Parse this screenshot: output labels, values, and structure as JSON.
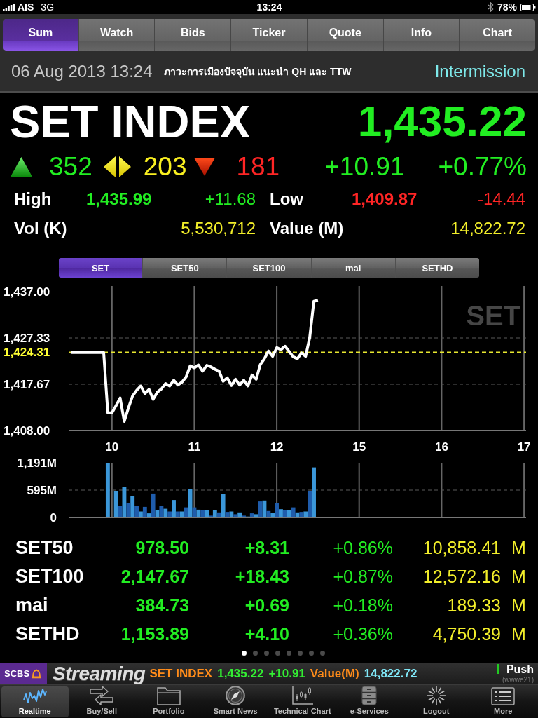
{
  "status_bar": {
    "carrier": "AIS",
    "network": "3G",
    "time": "13:24",
    "battery": "78%"
  },
  "tabs": [
    {
      "label": "Sum",
      "selected": true
    },
    {
      "label": "Watch",
      "selected": false
    },
    {
      "label": "Bids",
      "selected": false
    },
    {
      "label": "Ticker",
      "selected": false
    },
    {
      "label": "Quote",
      "selected": false
    },
    {
      "label": "Info",
      "selected": false
    },
    {
      "label": "Chart",
      "selected": false
    }
  ],
  "info_bar": {
    "datetime": "06 Aug 2013 13:24",
    "news": "ภาวะการเมืองปัจจุบัน แนะนำ QH และ TTW",
    "session": "Intermission"
  },
  "index": {
    "name": "SET INDEX",
    "last": "1,435.22",
    "change": "+10.91",
    "percent": "+0.77%"
  },
  "breadth": [
    {
      "kind": "up",
      "count": "352"
    },
    {
      "kind": "unchanged",
      "count": "203"
    },
    {
      "kind": "down",
      "count": "181"
    }
  ],
  "stats": [
    {
      "kind": "up",
      "label": "High",
      "value": "1,435.99",
      "change": "+11.68"
    },
    {
      "kind": "down",
      "label": "Low",
      "value": "1,409.87",
      "change": "-14.44"
    },
    {
      "kind": "total",
      "label": "Vol (K)",
      "value": "5,530,712"
    },
    {
      "kind": "total",
      "label": "Value (M)",
      "value": "14,822.72"
    }
  ],
  "chart_tabs": [
    {
      "label": "SET",
      "selected": true
    },
    {
      "label": "SET50",
      "selected": false
    },
    {
      "label": "SET100",
      "selected": false
    },
    {
      "label": "mai",
      "selected": false
    },
    {
      "label": "SETHD",
      "selected": false
    }
  ],
  "price_chart": {
    "chart_data": {
      "type": "line",
      "title": "SET",
      "grid": true,
      "categories": [
        null,
        null,
        null,
        null,
        null,
        null,
        null,
        null,
        null,
        null,
        "10",
        null,
        null,
        null,
        null,
        null,
        null,
        null,
        null,
        null,
        null,
        null,
        null,
        null,
        null,
        null,
        null,
        null,
        null,
        null,
        "11",
        null,
        null,
        null,
        null,
        null,
        null,
        null,
        null,
        null,
        null,
        null,
        null,
        null,
        null,
        null,
        null,
        null,
        null,
        null,
        "12",
        null,
        null,
        null,
        null,
        null,
        null,
        null,
        null,
        null,
        null,
        null,
        null,
        null,
        null,
        null,
        null,
        null,
        null,
        null,
        "15",
        null,
        null,
        null,
        null,
        null,
        null,
        null,
        null,
        null,
        null,
        null,
        null,
        null,
        null,
        null,
        null,
        null,
        null,
        null,
        "16",
        null,
        null,
        null,
        null,
        null,
        null,
        null,
        null,
        null,
        null,
        null,
        null,
        null,
        null,
        null,
        null,
        null,
        null,
        null,
        "17"
      ],
      "values": [
        1424.3,
        1424.3,
        1424.3,
        1424.3,
        1424.3,
        1424.3,
        1424.3,
        1424.3,
        1424.3,
        1411.7,
        1411.7,
        1413.2,
        1414.8,
        1409.9,
        1412.7,
        1415.2,
        1416.4,
        1417.3,
        1415.7,
        1416.6,
        1414.5,
        1416,
        1416.7,
        1417.8,
        1417.3,
        1418.5,
        1417.5,
        1418.1,
        1419.2,
        1421.5,
        1421.1,
        1421.7,
        1420.4,
        1421.6,
        1421.3,
        1420.8,
        1420.4,
        1418.3,
        1419,
        1417.4,
        1418.7,
        1417.5,
        1418.5,
        1417.3,
        1419.6,
        1418.7,
        1421.8,
        1423,
        1424.6,
        1423.5,
        1425.3,
        1424.9,
        1425.6,
        1424.5,
        1423.4,
        1423,
        1424.2,
        1423.5,
        1427.4,
        1435,
        1435.2,
        null,
        null,
        null,
        null,
        null,
        null,
        null,
        null,
        null,
        null,
        null,
        null,
        null,
        null,
        null,
        null,
        null,
        null,
        null,
        null,
        null,
        null,
        null,
        null,
        null,
        null,
        null,
        null,
        null,
        null,
        null,
        null,
        null,
        null,
        null,
        null,
        null,
        null,
        null,
        null,
        null,
        null,
        null,
        null,
        null,
        null,
        null,
        null,
        null,
        null
      ],
      "ylim": [
        1408,
        1437
      ],
      "yticks": [
        {
          "value": 1408,
          "label": "1,408.00"
        },
        {
          "value": 1417.67,
          "label": "1,417.67"
        },
        {
          "value": 1427.33,
          "label": "1,427.33"
        },
        {
          "value": 1437,
          "label": "1,437.00"
        }
      ],
      "ref_lines": [
        {
          "axis": "y",
          "value": 1424.31,
          "label": "1,424.31"
        }
      ]
    }
  },
  "volume_chart": {
    "chart_data": {
      "type": "bar",
      "grid": true,
      "categories": [
        null,
        null,
        null,
        null,
        null,
        null,
        null,
        null,
        null,
        null,
        null,
        null,
        null,
        null,
        null,
        null,
        null,
        null,
        null,
        null,
        null,
        null,
        null,
        null,
        null,
        null,
        null,
        null,
        null,
        null,
        null,
        null,
        null,
        null,
        null,
        null,
        null,
        null,
        null,
        null,
        null,
        null,
        null,
        null,
        null,
        null,
        null,
        null,
        null,
        null,
        null,
        null,
        null,
        null,
        null,
        null,
        null,
        null,
        null,
        null,
        null,
        null,
        null,
        null,
        null,
        null,
        null,
        null,
        null,
        null,
        null,
        null,
        null,
        null,
        null,
        null,
        null,
        null,
        null,
        null,
        null,
        null,
        null,
        null,
        null,
        null,
        null,
        null,
        null,
        null,
        null,
        null,
        null,
        null,
        null,
        null,
        null,
        null,
        null,
        null,
        null,
        null,
        null,
        null,
        null,
        null,
        null,
        null,
        null,
        null,
        null
      ],
      "series": [
        {
          "color": "#3b97d9",
          "values": [
            null,
            null,
            null,
            null,
            null,
            null,
            null,
            null,
            null,
            1190,
            null,
            580,
            null,
            660,
            null,
            460,
            null,
            130,
            null,
            90,
            null,
            160,
            null,
            190,
            null,
            380,
            null,
            130,
            null,
            620,
            null,
            170,
            null,
            160,
            null,
            160,
            null,
            510,
            null,
            130,
            null,
            110,
            null,
            20,
            null,
            70,
            null,
            370,
            null,
            100,
            null,
            180,
            null,
            160,
            null,
            110,
            null,
            130,
            null,
            1090,
            null,
            null,
            null,
            null,
            null,
            null,
            null,
            null,
            null,
            null,
            null,
            null,
            null,
            null,
            null,
            null,
            null,
            null,
            null,
            null,
            null,
            null,
            null,
            null,
            null,
            null,
            null,
            null,
            null,
            null,
            null,
            null,
            null,
            null,
            null,
            null,
            null,
            null,
            null,
            null,
            null,
            null,
            null,
            null,
            null,
            null,
            null,
            null,
            null,
            null,
            null
          ]
        },
        {
          "color": "#1f5cab",
          "values": [
            null,
            null,
            null,
            null,
            null,
            null,
            null,
            null,
            null,
            null,
            null,
            null,
            250,
            null,
            320,
            null,
            250,
            null,
            230,
            null,
            520,
            null,
            250,
            null,
            130,
            null,
            130,
            null,
            220,
            null,
            220,
            null,
            160,
            null,
            40,
            null,
            110,
            null,
            120,
            null,
            70,
            null,
            40,
            null,
            90,
            null,
            350,
            null,
            140,
            null,
            310,
            null,
            160,
            null,
            220,
            null,
            120,
            null,
            580,
            null,
            null,
            null,
            null,
            null,
            null,
            null,
            null,
            null,
            null,
            null,
            null,
            null,
            null,
            null,
            null,
            null,
            null,
            null,
            null,
            null,
            null,
            null,
            null,
            null,
            null,
            null,
            null,
            null,
            null,
            null,
            null,
            null,
            null,
            null,
            null,
            null,
            null,
            null,
            null,
            null,
            null,
            null,
            null,
            null,
            null,
            null,
            null,
            null,
            null,
            null,
            null
          ]
        }
      ],
      "ylim": [
        0,
        1191
      ],
      "yticks": [
        {
          "value": 0,
          "label": "0"
        },
        {
          "value": 595,
          "label": "595M"
        },
        {
          "value": 1191,
          "label": "1,191M"
        }
      ],
      "ref_lines": [
        {
          "axis": "y",
          "value": 595
        }
      ]
    }
  },
  "sub_indices": [
    {
      "name": "SET50",
      "last": "978.50",
      "change": "+8.31",
      "percent": "+0.86%",
      "value": "10,858.41",
      "unit": "M"
    },
    {
      "name": "SET100",
      "last": "2,147.67",
      "change": "+18.43",
      "percent": "+0.87%",
      "value": "12,572.16",
      "unit": "M"
    },
    {
      "name": "mai",
      "last": "384.73",
      "change": "+0.69",
      "percent": "+0.18%",
      "value": "189.33",
      "unit": "M"
    },
    {
      "name": "SETHD",
      "last": "1,153.89",
      "change": "+4.10",
      "percent": "+0.36%",
      "value": "4,750.39",
      "unit": "M"
    }
  ],
  "page_dots": [
    {
      "selected": true
    },
    {
      "selected": false
    },
    {
      "selected": false
    },
    {
      "selected": false
    },
    {
      "selected": false
    },
    {
      "selected": false
    },
    {
      "selected": false
    },
    {
      "selected": false
    }
  ],
  "ticker": {
    "broker": "SCBS",
    "app": "Streaming",
    "items": [
      {
        "kind": "label",
        "text": "SET INDEX"
      },
      {
        "kind": "up",
        "text": "1,435.22"
      },
      {
        "kind": "up",
        "text": "+10.91"
      },
      {
        "kind": "label",
        "text": "Value(M)"
      },
      {
        "kind": "value",
        "text": "14,822.72"
      }
    ],
    "push": {
      "label": "Push",
      "on": true,
      "user": "(wwwe21)"
    }
  },
  "bottom_tabs": [
    {
      "label": "Realtime",
      "selected": true
    },
    {
      "label": "Buy/Sell",
      "selected": false
    },
    {
      "label": "Portfolio",
      "selected": false
    },
    {
      "label": "Smart News",
      "selected": false
    },
    {
      "label": "Technical Chart",
      "selected": false
    },
    {
      "label": "e-Services",
      "selected": false
    },
    {
      "label": "Logout",
      "selected": false
    },
    {
      "label": "More",
      "selected": false
    }
  ]
}
